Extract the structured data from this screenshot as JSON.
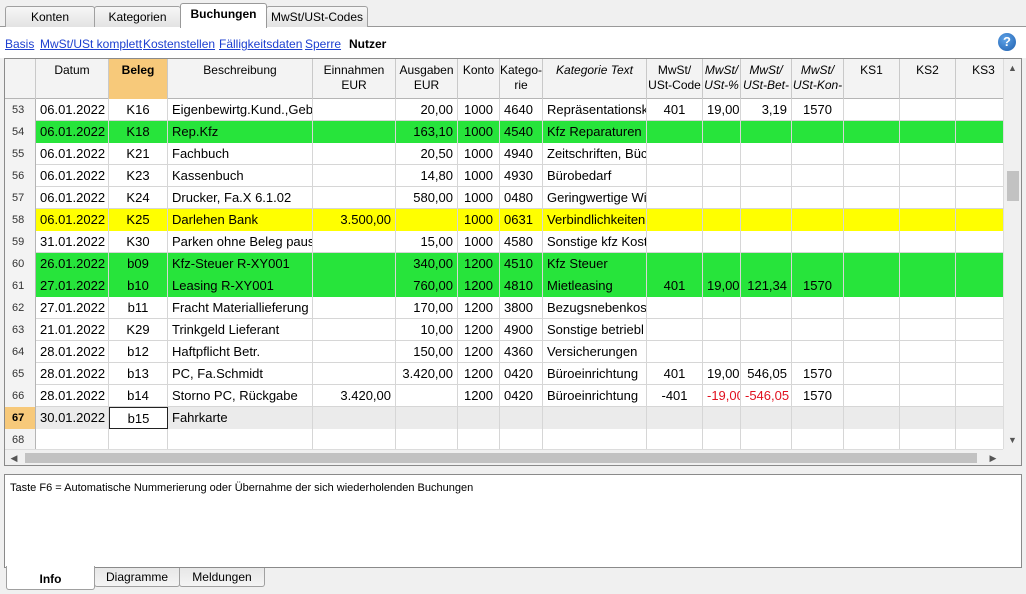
{
  "top_tabs": [
    "Konten",
    "Kategorien",
    "Buchungen",
    "MwSt/USt-Codes"
  ],
  "active_top_tab": 2,
  "views": [
    "Basis",
    "MwSt/USt komplett",
    "Kostenstellen",
    "Fälligkeitsdaten",
    "Sperre",
    "Nutzer"
  ],
  "active_view": 5,
  "help_label": "?",
  "columns": [
    {
      "label": ""
    },
    {
      "label": "Datum"
    },
    {
      "label": "Beleg"
    },
    {
      "label": "Beschreibung"
    },
    {
      "label": "Einnahmen\nEUR"
    },
    {
      "label": "Ausgaben\nEUR"
    },
    {
      "label": "Konto"
    },
    {
      "label": "Katego-\nrie"
    },
    {
      "label": "Kategorie Text",
      "italic": true
    },
    {
      "label": "MwSt/\nUSt-Code"
    },
    {
      "label": "MwSt/\nUSt-%",
      "italic": true
    },
    {
      "label": "MwSt/\nUSt-Bet-",
      "italic": true
    },
    {
      "label": "MwSt/\nUSt-Kon-",
      "italic": true
    },
    {
      "label": "KS1"
    },
    {
      "label": "KS2"
    },
    {
      "label": "KS3"
    }
  ],
  "active_column": 2,
  "rows": [
    {
      "nr": "53",
      "datum": "06.01.2022",
      "beleg": "K16",
      "beschreibung": "Eigenbewirtg.Kund.,Geb",
      "einnahmen": "",
      "ausgaben": "20,00",
      "konto": "1000",
      "kategorie": "4640",
      "kategorie_text": "Repräsentationsk",
      "mwst_code": "401",
      "mwst_pct": "19,00",
      "mwst_betrag": "3,19",
      "mwst_konto": "1570",
      "ks1": "",
      "ks2": "",
      "ks3": "",
      "style": ""
    },
    {
      "nr": "54",
      "datum": "06.01.2022",
      "beleg": "K18",
      "beschreibung": "Rep.Kfz",
      "einnahmen": "",
      "ausgaben": "163,10",
      "konto": "1000",
      "kategorie": "4540",
      "kategorie_text": "Kfz Reparaturen",
      "mwst_code": "",
      "mwst_pct": "",
      "mwst_betrag": "",
      "mwst_konto": "",
      "ks1": "",
      "ks2": "",
      "ks3": "",
      "style": "green"
    },
    {
      "nr": "55",
      "datum": "06.01.2022",
      "beleg": "K21",
      "beschreibung": "Fachbuch",
      "einnahmen": "",
      "ausgaben": "20,50",
      "konto": "1000",
      "kategorie": "4940",
      "kategorie_text": "Zeitschriften, Büc",
      "mwst_code": "",
      "mwst_pct": "",
      "mwst_betrag": "",
      "mwst_konto": "",
      "ks1": "",
      "ks2": "",
      "ks3": "",
      "style": ""
    },
    {
      "nr": "56",
      "datum": "06.01.2022",
      "beleg": "K23",
      "beschreibung": "Kassenbuch",
      "einnahmen": "",
      "ausgaben": "14,80",
      "konto": "1000",
      "kategorie": "4930",
      "kategorie_text": "Bürobedarf",
      "mwst_code": "",
      "mwst_pct": "",
      "mwst_betrag": "",
      "mwst_konto": "",
      "ks1": "",
      "ks2": "",
      "ks3": "",
      "style": ""
    },
    {
      "nr": "57",
      "datum": "06.01.2022",
      "beleg": "K24",
      "beschreibung": "Drucker, Fa.X 6.1.02",
      "einnahmen": "",
      "ausgaben": "580,00",
      "konto": "1000",
      "kategorie": "0480",
      "kategorie_text": "Geringwertige Wi",
      "mwst_code": "",
      "mwst_pct": "",
      "mwst_betrag": "",
      "mwst_konto": "",
      "ks1": "",
      "ks2": "",
      "ks3": "",
      "style": ""
    },
    {
      "nr": "58",
      "datum": "06.01.2022",
      "beleg": "K25",
      "beschreibung": "Darlehen Bank",
      "einnahmen": "3.500,00",
      "ausgaben": "",
      "konto": "1000",
      "kategorie": "0631",
      "kategorie_text": "Verbindlichkeiten",
      "mwst_code": "",
      "mwst_pct": "",
      "mwst_betrag": "",
      "mwst_konto": "",
      "ks1": "",
      "ks2": "",
      "ks3": "",
      "style": "yellow"
    },
    {
      "nr": "59",
      "datum": "31.01.2022",
      "beleg": "K30",
      "beschreibung": "Parken ohne Beleg paus",
      "einnahmen": "",
      "ausgaben": "15,00",
      "konto": "1000",
      "kategorie": "4580",
      "kategorie_text": "Sonstige kfz Kost",
      "mwst_code": "",
      "mwst_pct": "",
      "mwst_betrag": "",
      "mwst_konto": "",
      "ks1": "",
      "ks2": "",
      "ks3": "",
      "style": ""
    },
    {
      "nr": "60",
      "datum": "26.01.2022",
      "beleg": "b09",
      "beschreibung": "Kfz-Steuer R-XY001",
      "einnahmen": "",
      "ausgaben": "340,00",
      "konto": "1200",
      "kategorie": "4510",
      "kategorie_text": "Kfz Steuer",
      "mwst_code": "",
      "mwst_pct": "",
      "mwst_betrag": "",
      "mwst_konto": "",
      "ks1": "",
      "ks2": "",
      "ks3": "",
      "style": "green"
    },
    {
      "nr": "61",
      "datum": "27.01.2022",
      "beleg": "b10",
      "beschreibung": "Leasing R-XY001",
      "einnahmen": "",
      "ausgaben": "760,00",
      "konto": "1200",
      "kategorie": "4810",
      "kategorie_text": "Mietleasing",
      "mwst_code": "401",
      "mwst_pct": "19,00",
      "mwst_betrag": "121,34",
      "mwst_konto": "1570",
      "ks1": "",
      "ks2": "",
      "ks3": "",
      "style": "green"
    },
    {
      "nr": "62",
      "datum": "27.01.2022",
      "beleg": "b11",
      "beschreibung": "Fracht Materiallieferung",
      "einnahmen": "",
      "ausgaben": "170,00",
      "konto": "1200",
      "kategorie": "3800",
      "kategorie_text": "Bezugsnebenkos",
      "mwst_code": "",
      "mwst_pct": "",
      "mwst_betrag": "",
      "mwst_konto": "",
      "ks1": "",
      "ks2": "",
      "ks3": "",
      "style": ""
    },
    {
      "nr": "63",
      "datum": "21.01.2022",
      "beleg": "K29",
      "beschreibung": "Trinkgeld Lieferant",
      "einnahmen": "",
      "ausgaben": "10,00",
      "konto": "1200",
      "kategorie": "4900",
      "kategorie_text": "Sonstige betriebl",
      "mwst_code": "",
      "mwst_pct": "",
      "mwst_betrag": "",
      "mwst_konto": "",
      "ks1": "",
      "ks2": "",
      "ks3": "",
      "style": ""
    },
    {
      "nr": "64",
      "datum": "28.01.2022",
      "beleg": "b12",
      "beschreibung": "Haftpflicht Betr.",
      "einnahmen": "",
      "ausgaben": "150,00",
      "konto": "1200",
      "kategorie": "4360",
      "kategorie_text": "Versicherungen",
      "mwst_code": "",
      "mwst_pct": "",
      "mwst_betrag": "",
      "mwst_konto": "",
      "ks1": "",
      "ks2": "",
      "ks3": "",
      "style": ""
    },
    {
      "nr": "65",
      "datum": "28.01.2022",
      "beleg": "b13",
      "beschreibung": "PC, Fa.Schmidt",
      "einnahmen": "",
      "ausgaben": "3.420,00",
      "konto": "1200",
      "kategorie": "0420",
      "kategorie_text": "Büroeinrichtung",
      "mwst_code": "401",
      "mwst_pct": "19,00",
      "mwst_betrag": "546,05",
      "mwst_konto": "1570",
      "ks1": "",
      "ks2": "",
      "ks3": "",
      "style": ""
    },
    {
      "nr": "66",
      "datum": "28.01.2022",
      "beleg": "b14",
      "beschreibung": "Storno PC, Rückgabe",
      "einnahmen": "3.420,00",
      "ausgaben": "",
      "konto": "1200",
      "kategorie": "0420",
      "kategorie_text": "Büroeinrichtung",
      "mwst_code": "-401",
      "mwst_pct": "-19,00",
      "mwst_betrag": "-546,05",
      "mwst_konto": "1570",
      "ks1": "",
      "ks2": "",
      "ks3": "",
      "style": ""
    },
    {
      "nr": "67",
      "datum": "30.01.2022",
      "beleg": "b15",
      "beschreibung": "Fahrkarte",
      "einnahmen": "",
      "ausgaben": "",
      "konto": "",
      "kategorie": "",
      "kategorie_text": "",
      "mwst_code": "",
      "mwst_pct": "",
      "mwst_betrag": "",
      "mwst_konto": "",
      "ks1": "",
      "ks2": "",
      "ks3": "",
      "style": "cur"
    },
    {
      "nr": "68",
      "datum": "",
      "beleg": "",
      "beschreibung": "",
      "einnahmen": "",
      "ausgaben": "",
      "konto": "",
      "kategorie": "",
      "kategorie_text": "",
      "mwst_code": "",
      "mwst_pct": "",
      "mwst_betrag": "",
      "mwst_konto": "",
      "ks1": "",
      "ks2": "",
      "ks3": "",
      "style": ""
    }
  ],
  "active_row": 14,
  "negative_color": "#e0101e",
  "green_row_color": "#27e43b",
  "yellow_row_color": "#ffff00",
  "active_header_color": "#f7c97a",
  "info_text": "Taste F6 = Automatische Nummerierung oder Übernahme der sich wiederholenden Buchungen",
  "bottom_tabs": [
    "Info",
    "Diagramme",
    "Meldungen"
  ],
  "active_bottom_tab": 0
}
